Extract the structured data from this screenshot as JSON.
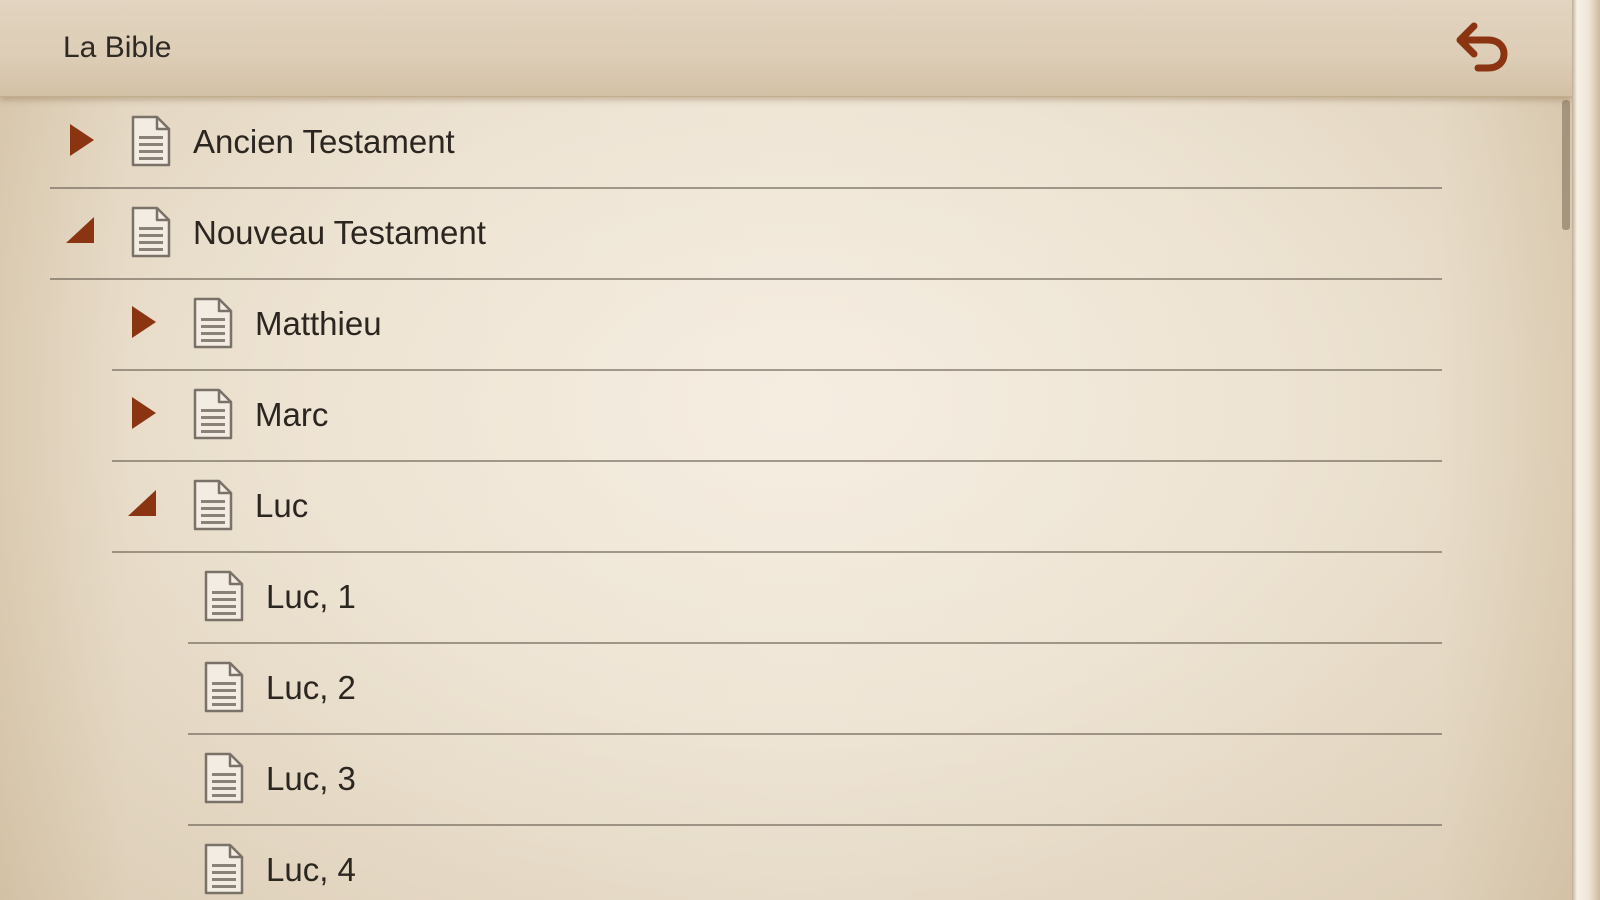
{
  "header": {
    "title": "La Bible",
    "back_icon": "undo-arrow-icon"
  },
  "colors": {
    "accent": "#8b3412",
    "text": "#2b2620",
    "paper": "#ede3d2"
  },
  "tree": {
    "items": [
      {
        "label": "Ancien Testament",
        "level": 0,
        "state": "collapsed"
      },
      {
        "label": "Nouveau Testament",
        "level": 0,
        "state": "expanded"
      },
      {
        "label": "Matthieu",
        "level": 1,
        "state": "collapsed"
      },
      {
        "label": "Marc",
        "level": 1,
        "state": "collapsed"
      },
      {
        "label": "Luc",
        "level": 1,
        "state": "expanded"
      },
      {
        "label": "Luc, 1",
        "level": 2,
        "state": "leaf"
      },
      {
        "label": "Luc, 2",
        "level": 2,
        "state": "leaf"
      },
      {
        "label": "Luc, 3",
        "level": 2,
        "state": "leaf"
      },
      {
        "label": "Luc, 4",
        "level": 2,
        "state": "leaf"
      }
    ]
  }
}
